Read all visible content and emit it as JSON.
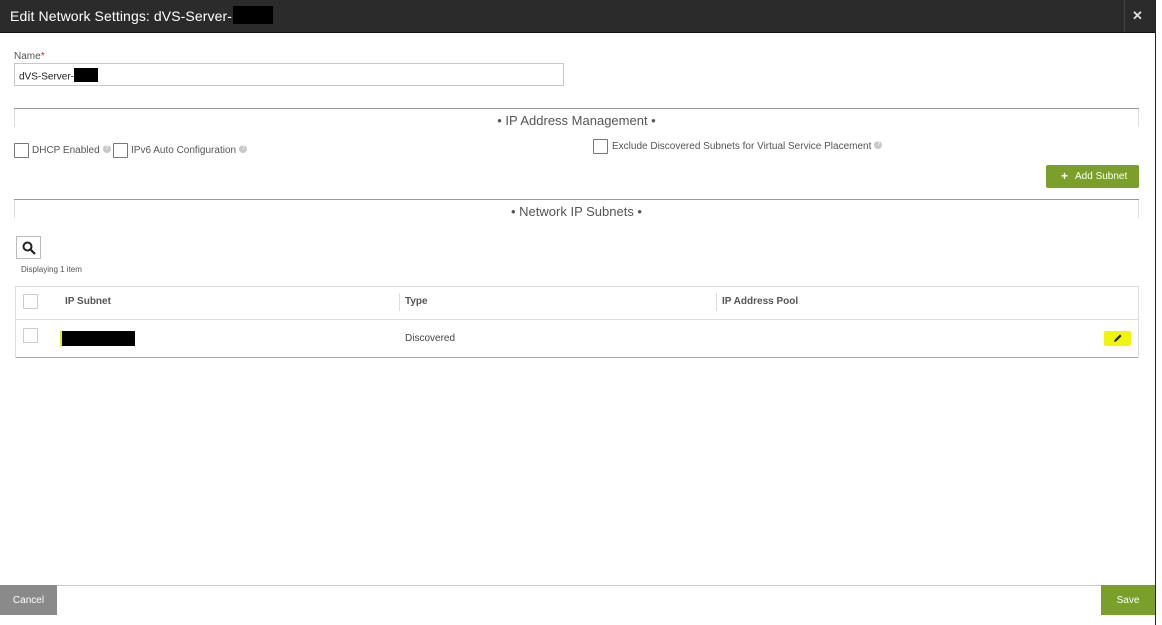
{
  "dialog": {
    "title": "Edit Network Settings: dVS-Server-",
    "close_icon": "close-icon"
  },
  "name_field": {
    "label": "Name",
    "required_mark": "*",
    "value": "dVS-Server-"
  },
  "ip_management": {
    "section_title": "• IP Address Management •",
    "dhcp_label": "DHCP Enabled",
    "ipv6_label": "IPv6 Auto Configuration",
    "exclude_label": "Exclude Discovered Subnets for Virtual Service Placement",
    "help_icon": "help-icon",
    "help_glyph": "?",
    "add_subnet_label": "Add Subnet",
    "add_subnet_icon": "+"
  },
  "subnets": {
    "section_title": "• Network IP Subnets •",
    "displaying_text": "Displaying 1 item",
    "columns": [
      "IP Subnet",
      "Type",
      "IP Address Pool"
    ],
    "rows": [
      {
        "ip_subnet": "",
        "type": "Discovered",
        "ip_address_pool": ""
      }
    ]
  },
  "footer": {
    "cancel_label": "Cancel",
    "save_label": "Save"
  },
  "colors": {
    "accent": "#7ba02a",
    "title_bar": "#2b2b2b",
    "highlight": "#f1f50a",
    "cancel": "#8a8a8a"
  }
}
